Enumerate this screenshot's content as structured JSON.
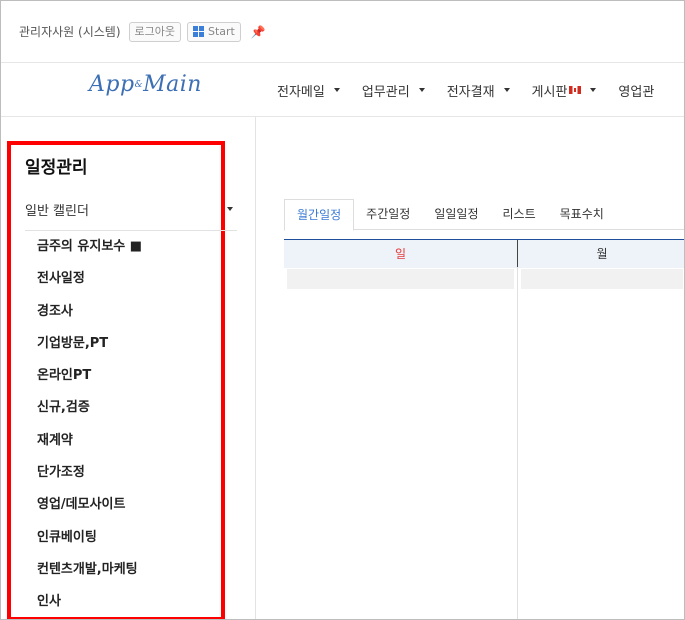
{
  "user_bar": {
    "user_name": "관리자사원 (시스템)",
    "logout_label": "로그아웃",
    "start_label": "Start"
  },
  "nav": {
    "logo_text": "App",
    "logo_sub": "&",
    "logo_text2": "Main",
    "menu": [
      {
        "label": "전자메일"
      },
      {
        "label": "업무관리"
      },
      {
        "label": "전자결재"
      },
      {
        "label": "게시판"
      },
      {
        "label": "영업관"
      }
    ]
  },
  "sidebar": {
    "title": "일정관리",
    "calendar_select": "일반 캘린더",
    "calendars": [
      "금주의 유지보수 ■",
      "전사일정",
      "경조사",
      "기업방문,PT",
      "온라인PT",
      "신규,검증",
      "재계약",
      "단가조정",
      "영업/데모사이트",
      "인큐베이팅",
      "컨텐츠개발,마케팅",
      "인사"
    ]
  },
  "calendar": {
    "tabs": [
      "월간일정",
      "주간일정",
      "일일일정",
      "리스트",
      "목표수치"
    ],
    "active_tab": "월간일정",
    "weekdays": [
      "일",
      "월"
    ]
  },
  "colors": {
    "highlight": "#ff0000",
    "accent": "#3a7bd5",
    "sunday": "#e23b3b",
    "logo": "#3c6fb4"
  }
}
